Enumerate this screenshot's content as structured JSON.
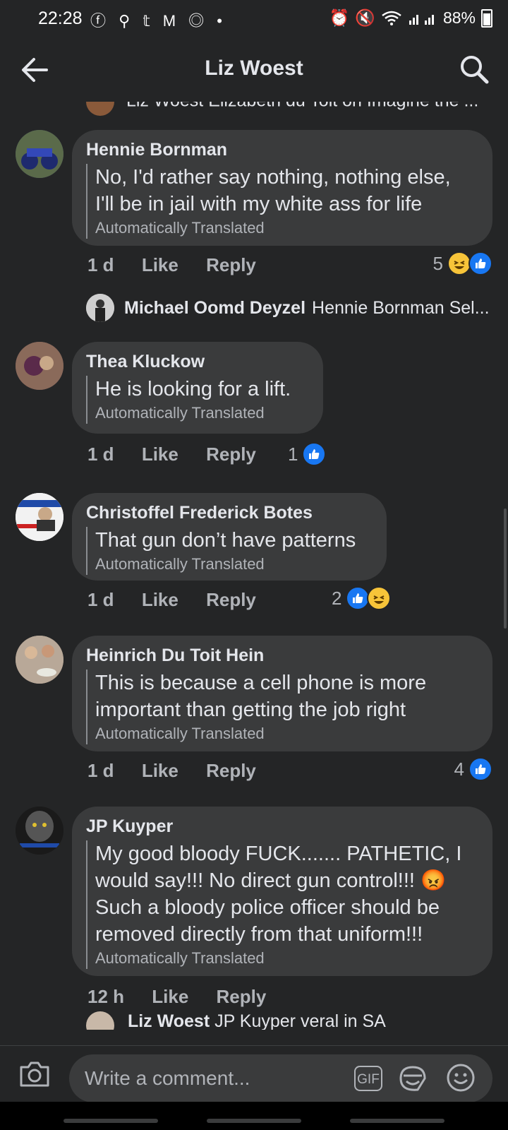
{
  "status_bar": {
    "time": "22:28",
    "app_icons": "ⓕ ⚲ 𝕥 M ◎ •",
    "battery": "88%"
  },
  "header": {
    "title": "Liz Woest"
  },
  "partial_top": {
    "text": "Liz Woest Elizabeth du Toit on Imagine the ..."
  },
  "comments": [
    {
      "author": "Hennie Bornman",
      "text": "No, I'd rather say nothing, nothing else,\nI'll be in jail with my white ass for life",
      "translated": "Automatically Translated",
      "time": "1 d",
      "like": "Like",
      "reply": "Reply",
      "reaction_count": "5",
      "reactions": [
        "haha",
        "like"
      ]
    },
    {
      "author": "Thea Kluckow",
      "text": "He is looking for a lift.",
      "translated": "Automatically Translated",
      "time": "1 d",
      "like": "Like",
      "reply": "Reply",
      "reaction_count": "1",
      "reactions": [
        "like"
      ]
    },
    {
      "author": "Christoffel Frederick Botes",
      "text": "That gun don’t have patterns",
      "translated": "Automatically Translated",
      "time": "1 d",
      "like": "Like",
      "reply": "Reply",
      "reaction_count": "2",
      "reactions": [
        "like",
        "haha"
      ]
    },
    {
      "author": "Heinrich Du Toit Hein",
      "text": "This is because a cell phone is more\nimportant than getting the job right",
      "translated": "Automatically Translated",
      "time": "1 d",
      "like": "Like",
      "reply": "Reply",
      "reaction_count": "4",
      "reactions": [
        "like"
      ]
    },
    {
      "author": "JP Kuyper",
      "text": "My good bloody FUCK....... PATHETIC, I\nwould say!!! No direct gun control!!! 😡\nSuch a bloody police officer should be\nremoved directly from that uniform!!!",
      "translated": "Automatically Translated",
      "time": "12 h",
      "like": "Like",
      "reply": "Reply"
    }
  ],
  "reply_preview": {
    "author": "Michael Oomd Deyzel",
    "text": "Hennie Bornman Sel..."
  },
  "bottom_partial": {
    "author": "Liz Woest",
    "text": "JP Kuyper veral in SA"
  },
  "composer": {
    "placeholder": "Write a comment...",
    "gif_label": "GIF"
  },
  "colors": {
    "background": "#242526",
    "bubble": "#3a3b3c",
    "like_blue": "#1877f2",
    "haha_yellow": "#f7c439"
  }
}
